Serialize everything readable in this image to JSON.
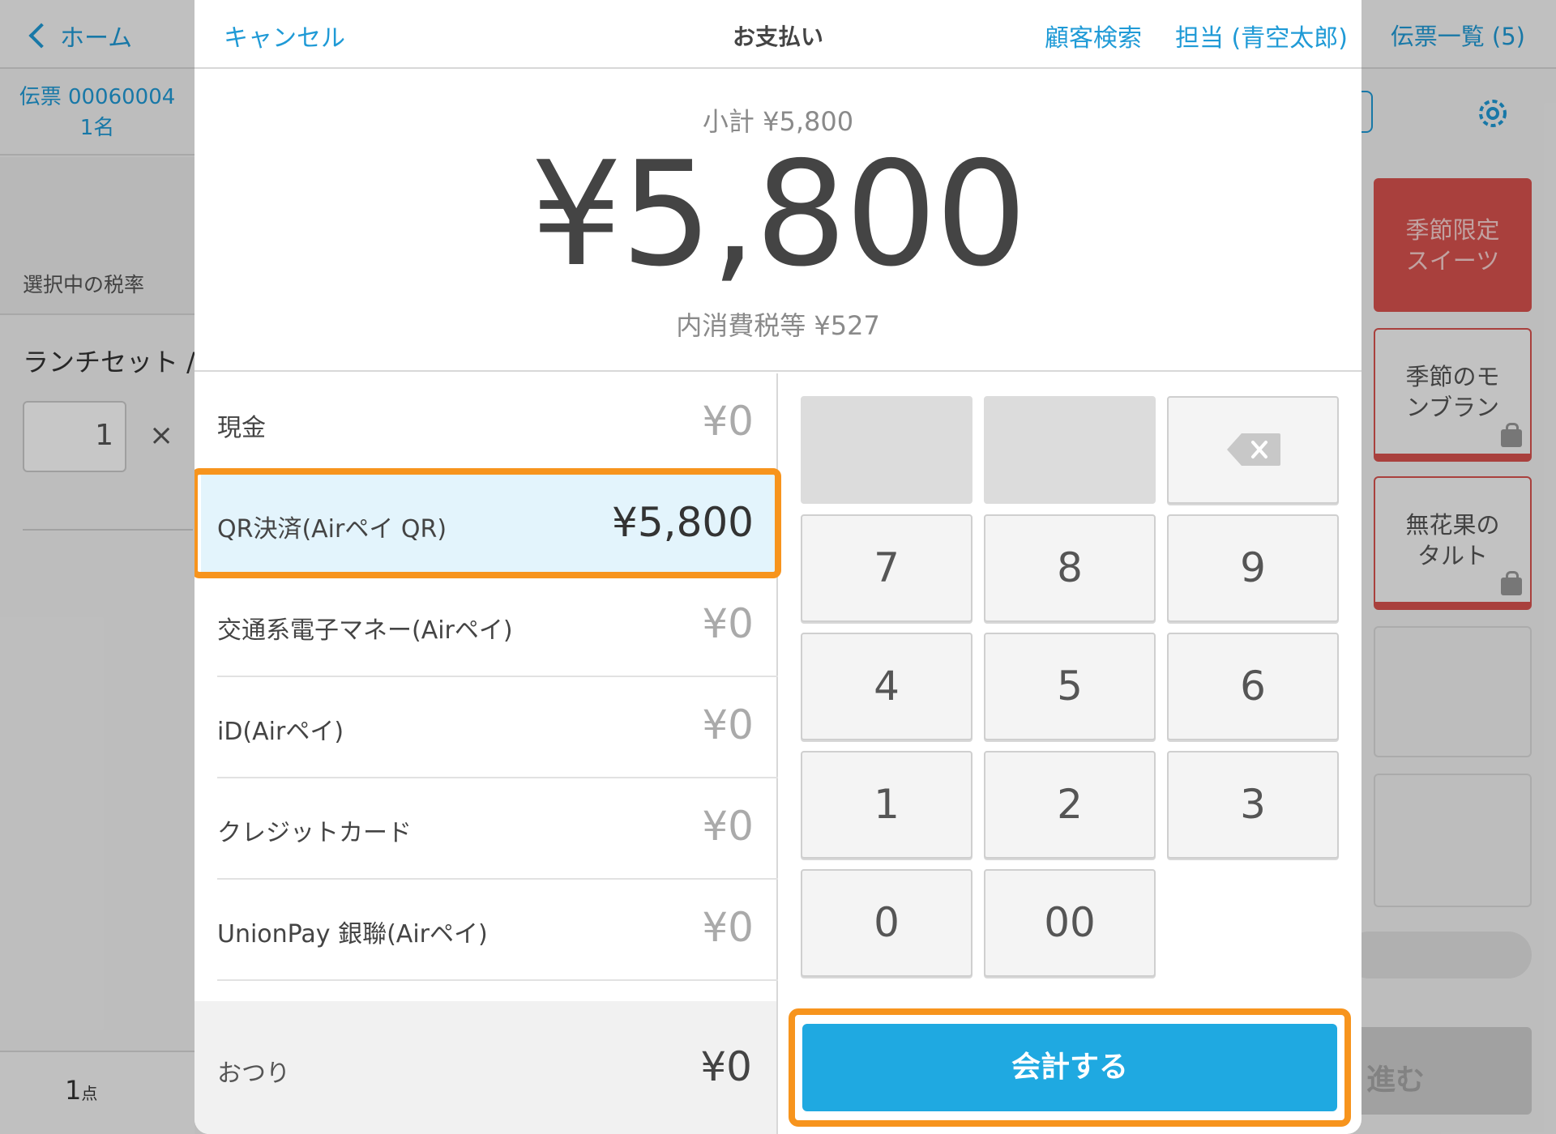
{
  "background": {
    "back_label": "ホーム",
    "tickets_label": "伝票一覧 (5)",
    "paren_fragment": ")",
    "slip_number": "伝票 00060004",
    "slip_guests": "1名",
    "tax_rate_label": "選択中の税率",
    "lunch_item": "ランチセット /",
    "quantity": "1",
    "times_symbol": "×",
    "item_count": "1",
    "item_count_unit": "点",
    "tiles": {
      "seasonal_sweets": "季節限定スイーツ",
      "mont_blanc": "季節のモンブラン",
      "fig_tart": "無花果のタルト"
    },
    "next_label": "進む",
    "colors": {
      "accent": "#1f9ad6",
      "tile_red": "#d9534f"
    }
  },
  "modal": {
    "cancel_label": "キャンセル",
    "title": "お支払い",
    "customer_search_label": "顧客検索",
    "staff_label": "担当 (青空太郎)",
    "subtotal": "小計 ¥5,800",
    "total": "¥5,800",
    "tax": "内消費税等 ¥527",
    "payment_methods": [
      {
        "label": "現金",
        "amount": "¥0",
        "selected": false
      },
      {
        "label": "QR決済(Airペイ QR)",
        "amount": "¥5,800",
        "selected": true
      },
      {
        "label": "交通系電子マネー(Airペイ)",
        "amount": "¥0",
        "selected": false
      },
      {
        "label": "iD(Airペイ)",
        "amount": "¥0",
        "selected": false
      },
      {
        "label": "クレジットカード",
        "amount": "¥0",
        "selected": false
      },
      {
        "label": "UnionPay 銀聯(Airペイ)",
        "amount": "¥0",
        "selected": false
      }
    ],
    "change_label": "おつり",
    "change_amount": "¥0",
    "keypad": {
      "k7": "7",
      "k8": "8",
      "k9": "9",
      "k4": "4",
      "k5": "5",
      "k6": "6",
      "k1": "1",
      "k2": "2",
      "k3": "3",
      "k0": "0",
      "k00": "00"
    },
    "checkout_label": "会計する",
    "colors": {
      "checkout": "#1fa9e1",
      "highlight": "#f7941d",
      "selected_row": "#e3f4fc"
    }
  }
}
